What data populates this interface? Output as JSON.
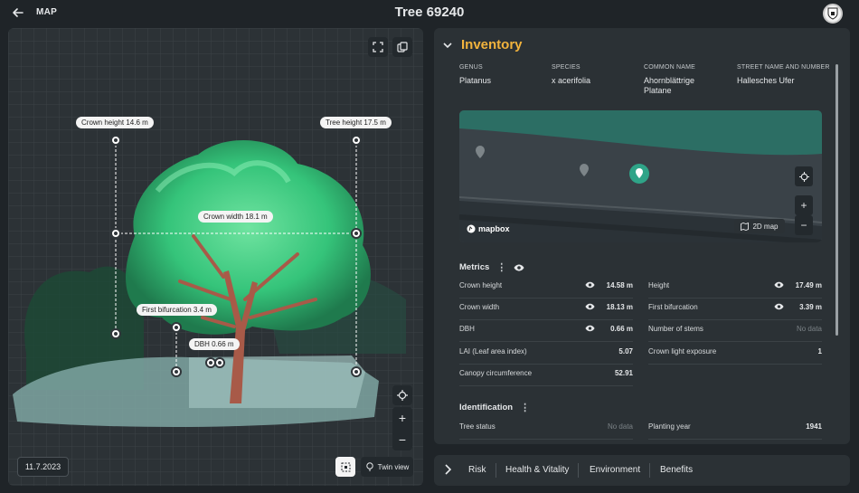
{
  "header": {
    "back_label": "MAP",
    "title": "Tree 69240"
  },
  "scan": {
    "measurements": {
      "crown_height": "Crown height 14.6 m",
      "tree_height": "Tree height 17.5 m",
      "crown_width": "Crown width 18.1 m",
      "first_bifurcation": "First bifurcation 3.4 m",
      "dbh": "DBH 0.66 m"
    },
    "date": "11.7.2023",
    "twin_view_label": "Twin view",
    "zoom_in": "+",
    "zoom_out": "−"
  },
  "inventory": {
    "title": "Inventory",
    "fields": [
      {
        "key": "GENUS",
        "value": "Platanus"
      },
      {
        "key": "SPECIES",
        "value": "x acerifolia"
      },
      {
        "key": "COMMON NAME",
        "value": "Ahornblättrige Platane"
      },
      {
        "key": "STREET NAME AND NUMBER",
        "value": "Hallesches Ufer"
      }
    ],
    "map": {
      "logo": "mapbox",
      "mode_button": "2D map",
      "zoom_in": "+",
      "zoom_out": "−"
    },
    "metrics_title": "Metrics",
    "metrics_left": [
      {
        "label": "Crown height",
        "value": "14.58 m",
        "eye": true
      },
      {
        "label": "Crown width",
        "value": "18.13 m",
        "eye": true
      },
      {
        "label": "DBH",
        "value": "0.66 m",
        "eye": true
      },
      {
        "label": "LAI (Leaf area index)",
        "value": "5.07",
        "eye": false
      },
      {
        "label": "Canopy circumference",
        "value": "52.91",
        "eye": false
      }
    ],
    "metrics_right": [
      {
        "label": "Height",
        "value": "17.49 m",
        "eye": true
      },
      {
        "label": "First bifurcation",
        "value": "3.39 m",
        "eye": true
      },
      {
        "label": "Number of stems",
        "value": "No data",
        "eye": false
      },
      {
        "label": "Crown light exposure",
        "value": "1",
        "eye": false
      }
    ],
    "identification_title": "Identification",
    "identification_left": [
      {
        "label": "Tree status",
        "value": "No data"
      }
    ],
    "identification_right": [
      {
        "label": "Planting year",
        "value": "1941"
      }
    ]
  },
  "tabs": [
    "Risk",
    "Health & Vitality",
    "Environment",
    "Benefits"
  ],
  "colors": {
    "accent": "#f2b33d",
    "point_cloud": "#3fcf7f",
    "trunk": "#a85a48",
    "ground": "#8fb3b0"
  }
}
